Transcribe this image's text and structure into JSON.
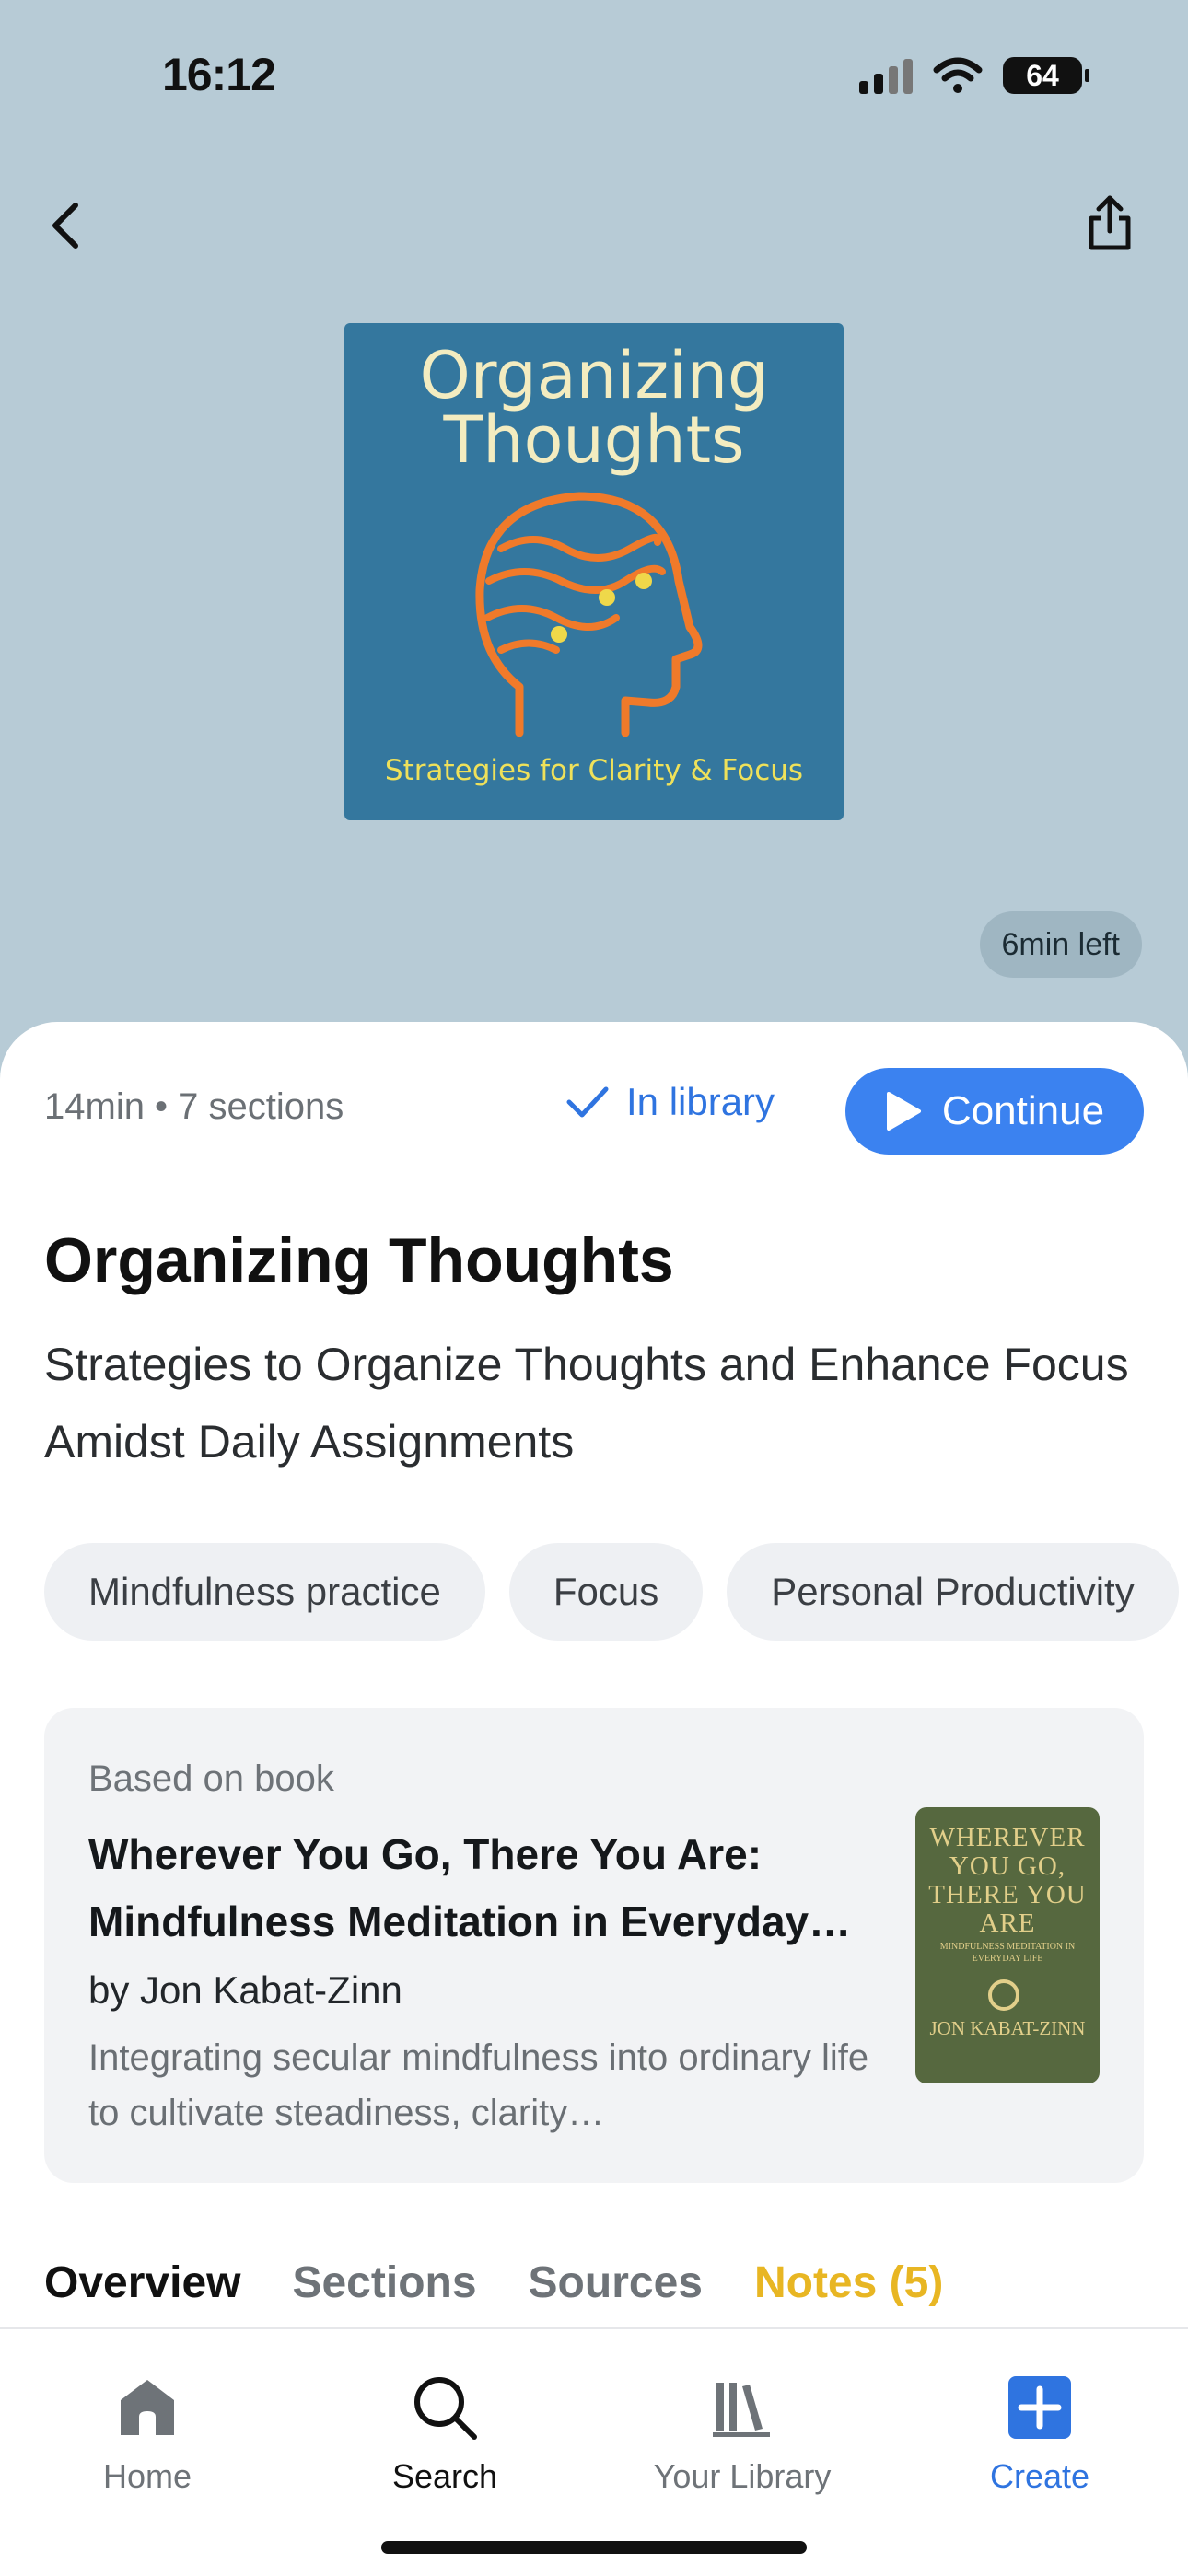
{
  "status_bar": {
    "time": "16:12",
    "battery": "64"
  },
  "cover": {
    "title": "Organizing Thoughts",
    "subtitle": "Strategies for Clarity & Focus"
  },
  "time_left": "6min left",
  "meta": "14min • 7 sections",
  "in_library_label": "In library",
  "continue_label": "Continue",
  "title": "Organizing Thoughts",
  "subtitle": "Strategies to Organize Thoughts and Enhance Focus Amidst Daily Assignments",
  "tags": [
    "Mindfulness practice",
    "Focus",
    "Personal Productivity"
  ],
  "book": {
    "label": "Based on book",
    "title": "Wherever You Go, There You Are: Mindfulness Meditation in Everyday…",
    "author": "by Jon Kabat-Zinn",
    "description": "Integrating secular mindfulness into ordinary life to cultivate steadiness, clarity…",
    "cover_title": "WHEREVER YOU GO, THERE YOU ARE",
    "cover_subtitle": "MINDFULNESS MEDITATION IN EVERYDAY LIFE",
    "cover_author": "JON KABAT-ZINN"
  },
  "tabs": [
    "Overview",
    "Sections",
    "Sources",
    "Notes (5)"
  ],
  "bottom_nav": [
    {
      "label": "Home",
      "icon": "home-icon"
    },
    {
      "label": "Search",
      "icon": "search-icon"
    },
    {
      "label": "Your Library",
      "icon": "library-icon"
    },
    {
      "label": "Create",
      "icon": "plus-icon"
    }
  ],
  "colors": {
    "header_bg": "#b7cbd6",
    "accent": "#3b82f0",
    "notes_tab": "#e8b623",
    "cover_bg": "#34779e"
  }
}
